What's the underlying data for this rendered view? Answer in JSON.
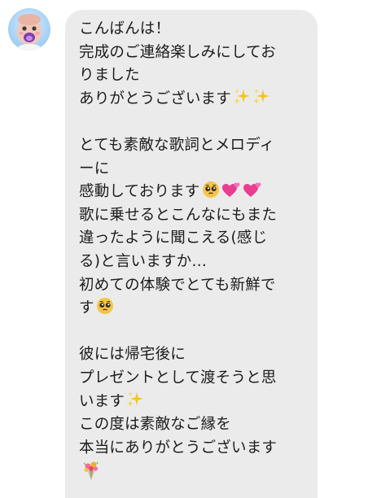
{
  "message": {
    "lines": [
      {
        "text": "こんばんは！",
        "emoji": []
      },
      {
        "text": "完成のご連絡楽しみにしてお",
        "emoji": []
      },
      {
        "text": "りました",
        "emoji": []
      },
      {
        "text": "ありがとうございます",
        "emoji": [
          "sparkles-icon",
          "sparkles-icon"
        ]
      },
      {
        "text": "",
        "emoji": []
      },
      {
        "text": "とても素敵な歌詞とメロディ",
        "emoji": []
      },
      {
        "text": "ーに",
        "emoji": []
      },
      {
        "text": "感動しております",
        "emoji": [
          "pleading-face-icon",
          "two-hearts-icon",
          "two-hearts-icon"
        ]
      },
      {
        "text": "歌に乗せるとこんなにもまた",
        "emoji": []
      },
      {
        "text": "違ったように聞こえる(感じ",
        "emoji": []
      },
      {
        "text": "る)と言いますか…",
        "emoji": []
      },
      {
        "text": "初めての体験でとても新鮮で",
        "emoji": []
      },
      {
        "text": "す",
        "emoji": [
          "pleading-face-icon"
        ]
      },
      {
        "text": "",
        "emoji": []
      },
      {
        "text": "彼には帰宅後に",
        "emoji": []
      },
      {
        "text": "プレゼントとして渡そうと思",
        "emoji": []
      },
      {
        "text": "います",
        "emoji": [
          "sparkles-icon"
        ]
      },
      {
        "text": "この度は素敵なご縁を",
        "emoji": []
      },
      {
        "text": "本当にありがとうございます",
        "emoji": []
      },
      {
        "text": "",
        "emoji": [
          "bouquet-icon"
        ]
      }
    ]
  },
  "avatar": {
    "icon": "baby-avatar-icon"
  },
  "colors": {
    "bubble": "#ebebeb",
    "text": "#1c1c1e",
    "background": "#ffffff"
  }
}
